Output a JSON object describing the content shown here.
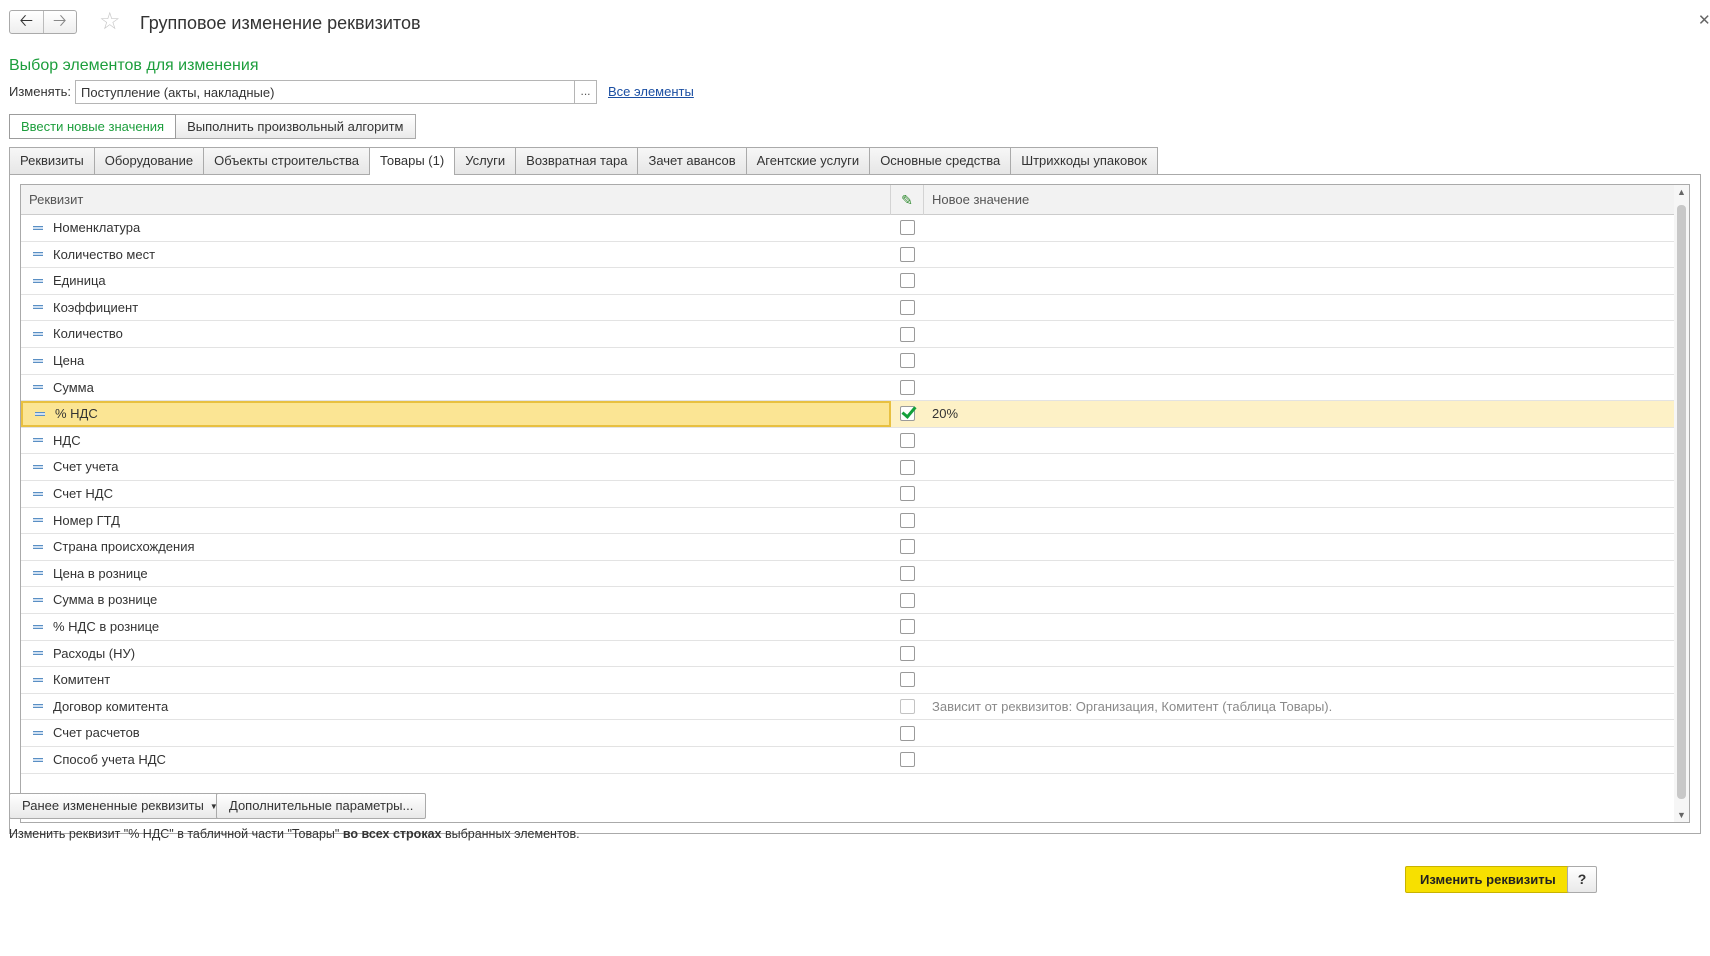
{
  "window": {
    "title": "Групповое изменение реквизитов",
    "nav_back_icon": "arrow-left-icon",
    "nav_forward_icon": "arrow-right-icon",
    "favorite_icon": "star-icon",
    "close_icon": "close-icon"
  },
  "selection": {
    "subtitle": "Выбор элементов для изменения",
    "change_label": "Изменять:",
    "change_value": "Поступление (акты, накладные)",
    "choose_button": "...",
    "all_elements_link": "Все элементы"
  },
  "modes": [
    {
      "label": "Ввести новые значения",
      "active": true
    },
    {
      "label": "Выполнить произвольный алгоритм",
      "active": false
    }
  ],
  "tabs": [
    {
      "label": "Реквизиты",
      "active": false
    },
    {
      "label": "Оборудование",
      "active": false
    },
    {
      "label": "Объекты строительства",
      "active": false
    },
    {
      "label": "Товары (1)",
      "active": true
    },
    {
      "label": "Услуги",
      "active": false
    },
    {
      "label": "Возвратная тара",
      "active": false
    },
    {
      "label": "Зачет авансов",
      "active": false
    },
    {
      "label": "Агентские услуги",
      "active": false
    },
    {
      "label": "Основные средства",
      "active": false
    },
    {
      "label": "Штрихкоды упаковок",
      "active": false
    }
  ],
  "table": {
    "columns": {
      "name": "Реквизит",
      "check_icon": "pencil-icon",
      "value": "Новое значение"
    },
    "rows": [
      {
        "name": "Номенклатура",
        "checked": false,
        "value": ""
      },
      {
        "name": "Количество мест",
        "checked": false,
        "value": ""
      },
      {
        "name": "Единица",
        "checked": false,
        "value": ""
      },
      {
        "name": "Коэффициент",
        "checked": false,
        "value": ""
      },
      {
        "name": "Количество",
        "checked": false,
        "value": ""
      },
      {
        "name": "Цена",
        "checked": false,
        "value": ""
      },
      {
        "name": "Сумма",
        "checked": false,
        "value": ""
      },
      {
        "name": "% НДС",
        "checked": true,
        "value": "20%",
        "selected": true
      },
      {
        "name": "НДС",
        "checked": false,
        "value": ""
      },
      {
        "name": "Счет учета",
        "checked": false,
        "value": ""
      },
      {
        "name": "Счет НДС",
        "checked": false,
        "value": ""
      },
      {
        "name": "Номер ГТД",
        "checked": false,
        "value": ""
      },
      {
        "name": "Страна происхождения",
        "checked": false,
        "value": ""
      },
      {
        "name": "Цена в рознице",
        "checked": false,
        "value": ""
      },
      {
        "name": "Сумма в рознице",
        "checked": false,
        "value": ""
      },
      {
        "name": "% НДС в рознице",
        "checked": false,
        "value": ""
      },
      {
        "name": "Расходы (НУ)",
        "checked": false,
        "value": ""
      },
      {
        "name": "Комитент",
        "checked": false,
        "value": ""
      },
      {
        "name": "Договор комитента",
        "checked": false,
        "value": "Зависит от реквизитов: Организация, Комитент (таблица Товары).",
        "disabled": true
      },
      {
        "name": "Счет расчетов",
        "checked": false,
        "value": ""
      },
      {
        "name": "Способ учета НДС",
        "checked": false,
        "value": ""
      }
    ]
  },
  "bottom": {
    "prev_button": "Ранее измененные реквизиты",
    "extra_button": "Дополнительные параметры...",
    "info_prefix": "Изменить реквизит \"% НДС\" в табличной части \"Товары\" ",
    "info_bold": "во всех строках",
    "info_suffix": " выбранных элементов.",
    "apply_button": "Изменить реквизиты",
    "help_button": "?"
  },
  "colors": {
    "accent_green": "#1c9e3c",
    "link_blue": "#1a4ea2",
    "selected_row": "#fbe594",
    "apply_yellow": "#f7e000"
  }
}
